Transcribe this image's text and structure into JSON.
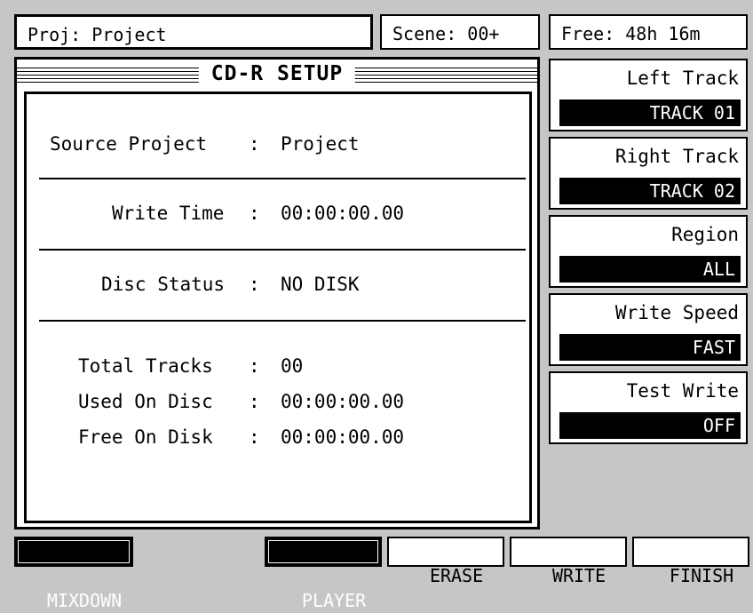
{
  "header": {
    "project": "Proj: Project",
    "scene": "Scene: 00+",
    "free": "Free: 48h 16m"
  },
  "main": {
    "title": "CD-R SETUP",
    "rows": [
      {
        "label": "Source Project",
        "sep": ":",
        "value": "Project"
      },
      {
        "label": "Write Time",
        "sep": ":",
        "value": "00:00:00.00"
      },
      {
        "label": "Disc Status",
        "sep": ":",
        "value": "NO DISK"
      },
      {
        "label": "Total Tracks",
        "sep": ":",
        "value": "00"
      },
      {
        "label": "Used On Disc",
        "sep": ":",
        "value": "00:00:00.00"
      },
      {
        "label": "Free On Disk",
        "sep": ":",
        "value": "00:00:00.00"
      }
    ]
  },
  "settings": [
    {
      "label": "Left Track",
      "value": "TRACK 01"
    },
    {
      "label": "Right Track",
      "value": "TRACK 02"
    },
    {
      "label": "Region",
      "value": "ALL"
    },
    {
      "label": "Write Speed",
      "value": "FAST"
    },
    {
      "label": "Test Write",
      "value": "OFF"
    }
  ],
  "buttons": {
    "mixdown": "MIXDOWN",
    "player": "PLAYER",
    "erase": "ERASE",
    "write": "WRITE",
    "finish": "FINISH"
  }
}
